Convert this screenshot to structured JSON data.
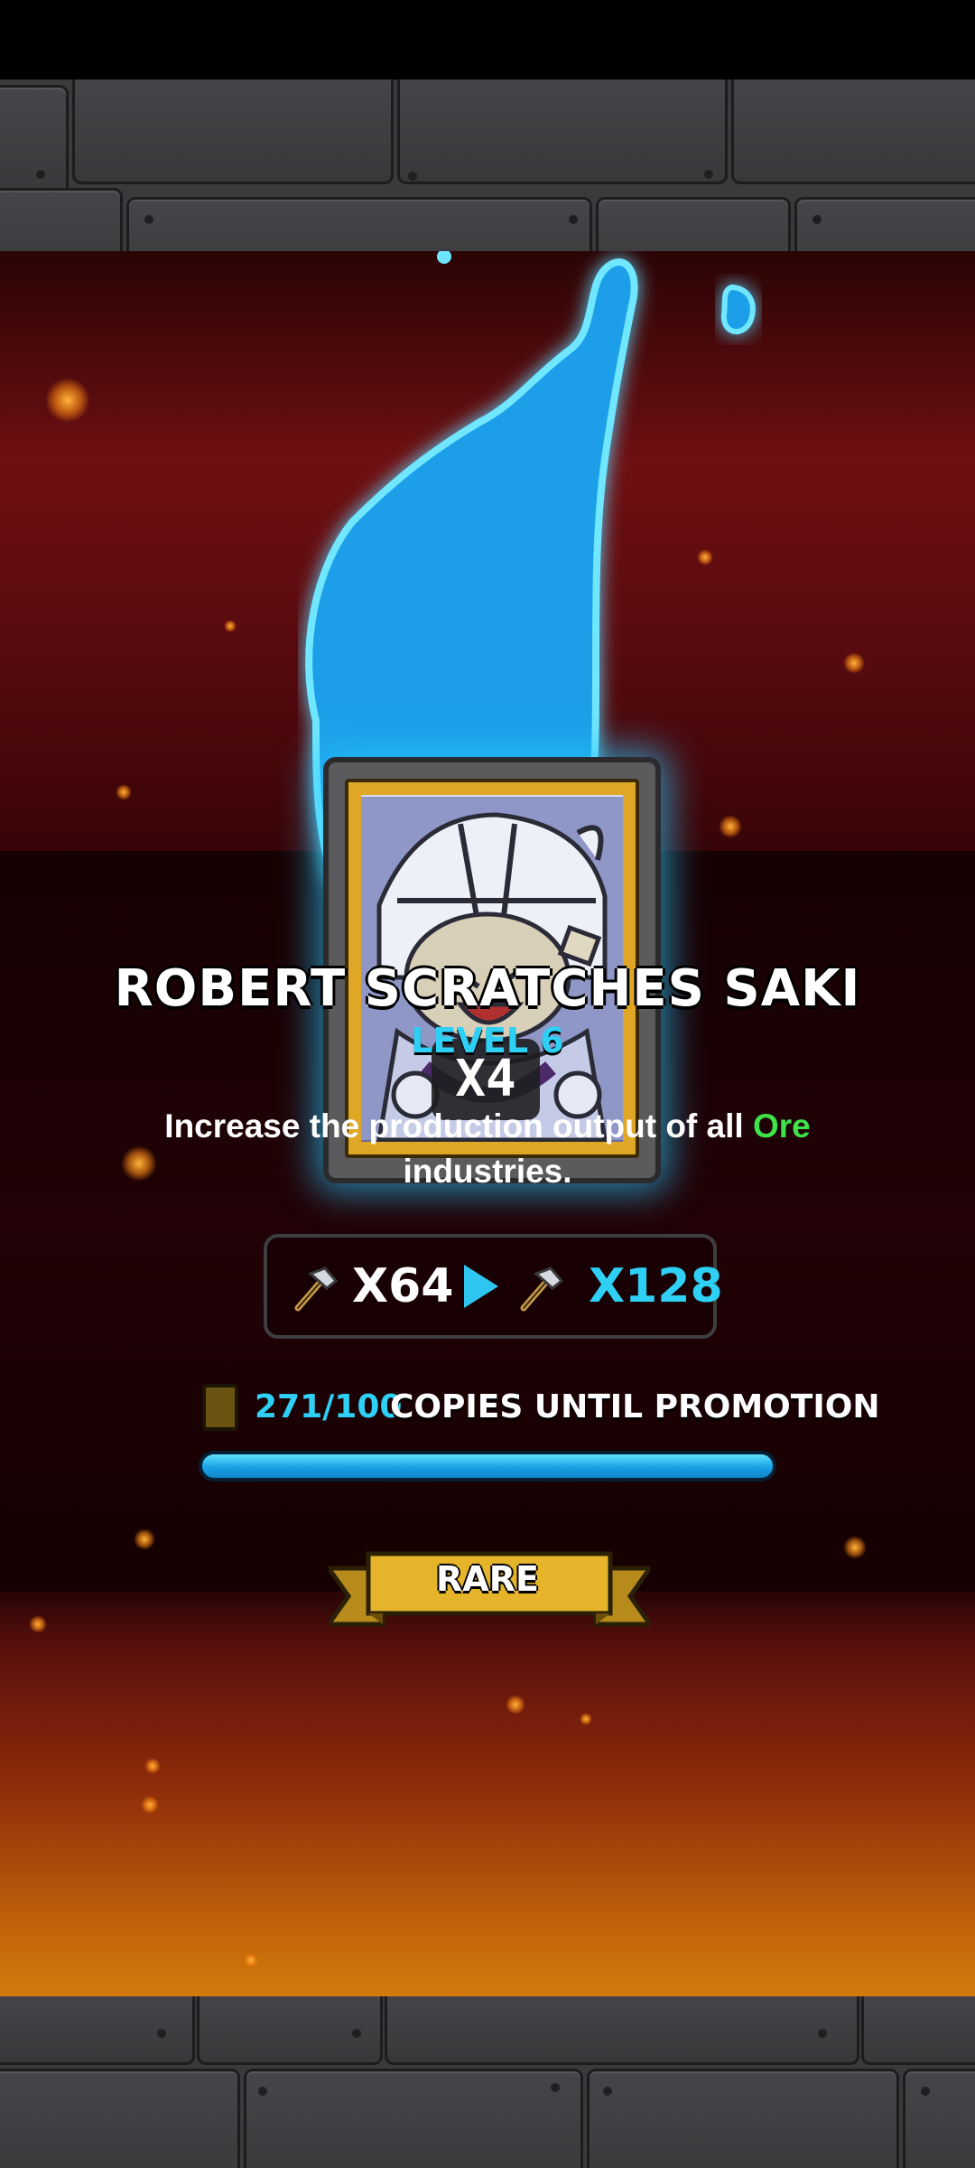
{
  "card": {
    "name": "ROBERT SCRATCHES SAKI",
    "level": "LEVEL 6",
    "count": "X4",
    "description_prefix": "Increase the production output of all ",
    "description_highlight": "Ore",
    "description_suffix": " industries.",
    "rarity": "RARE",
    "boost_from": "X64",
    "boost_to": "X128",
    "copies_count": "271/100",
    "copies_label": "COPIES UNTIL PROMOTION",
    "progress": 1.0
  },
  "icons": {
    "boost_from_icon": "hammer-icon",
    "boost_to_icon": "hammer-icon",
    "arrow": "play-arrow-icon",
    "copies_icon": "card-icon"
  },
  "colors": {
    "accent_cyan": "#2ed0f5",
    "highlight_green": "#3ee34a",
    "rarity_gold": "#e6b42a"
  }
}
